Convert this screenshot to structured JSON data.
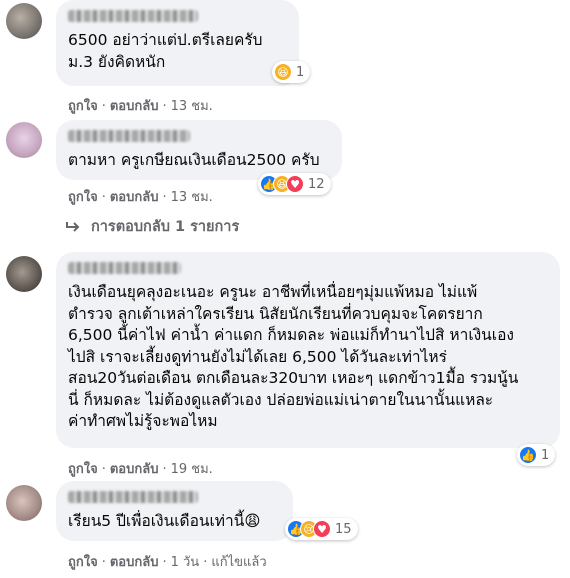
{
  "comments": [
    {
      "text": "6500 อย่าว่าแต่ป.ตรีเลยครับ\nม.3 ยังคิดหนัก",
      "like_label": "ถูกใจ",
      "reply_label": "ตอบกลับ",
      "time": "13 ชม.",
      "reaction_count": "1",
      "reactions": [
        "haha-icon"
      ]
    },
    {
      "text": "ตามหา ครูเกษียณเงินเดือน2500 ครับ",
      "like_label": "ถูกใจ",
      "reply_label": "ตอบกลับ",
      "time": "13 ชม.",
      "reaction_count": "12",
      "reactions": [
        "like-icon",
        "haha-icon",
        "love-icon"
      ]
    },
    {
      "text": "เงินเดือนยุคลุงอะเนอะ ครูนะ อาชีพที่เหนื่อยๆมุ่มแพ้หมอ ไม่แพ้\nตำรวจ ลูกเต้าเหล่าใครเรียน นิสัยนักเรียนที่ควบคุมจะโคตรยาก\n6,500 นี้ค่าไฟ ค่าน้ำ ค่าแดก ก็หมดละ พ่อแม่ก็ทำนาไปสิ หาเงินเอง\nไปสิ เราจะเลี้ยงดูท่านยังไม่ได้เลย 6,500 ได้วันละเท่าไหร่\nสอน20วันต่อเดือน ตกเดือนละ320บาท เหอะๆ แดกข้าว1มื้อ รวมนู้น\nนี่ ก็หมดละ ไม่ต้องดูแลตัวเอง ปล่อยพ่อแม่เน่าตายในนานั้นแหละ\nค่าทำศพไม่รู้จะพอไหม",
      "like_label": "ถูกใจ",
      "reply_label": "ตอบกลับ",
      "time": "19 ชม.",
      "reaction_count": "1",
      "reactions": [
        "like-icon"
      ]
    },
    {
      "text": "เรียน5 ปีเพื่อเงินเดือนเท่านี้😩",
      "like_label": "ถูกใจ",
      "reply_label": "ตอบกลับ",
      "time": "1 วัน",
      "edited_label": "แก้ไขแล้ว",
      "reaction_count": "15",
      "reactions": [
        "like-icon",
        "sad-icon",
        "love-icon"
      ]
    }
  ],
  "replies_link": "การตอบกลับ 1 รายการ",
  "colors": {
    "bubble": "#f0f2f5",
    "meta": "#65676b",
    "like": "#1877f2",
    "love": "#f33e58",
    "haha": "#f7b125"
  }
}
